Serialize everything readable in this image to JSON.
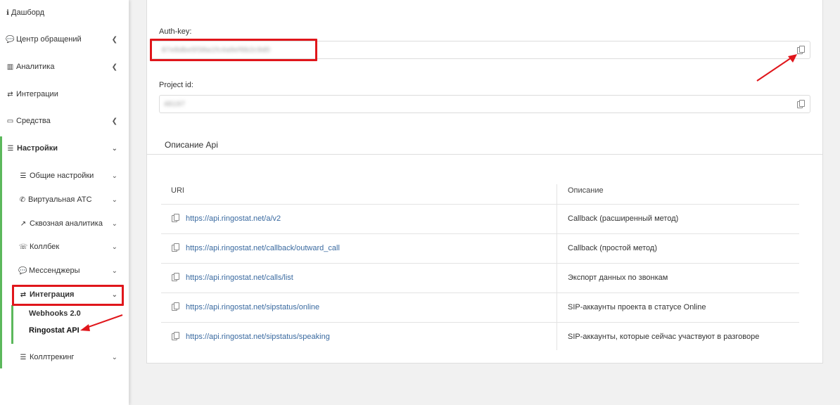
{
  "sidebar": {
    "items": [
      {
        "label": "Дашборд",
        "icon": "info-icon"
      },
      {
        "label": "Центр обращений",
        "icon": "chat-icon"
      },
      {
        "label": "Аналитика",
        "icon": "bar-chart-icon"
      },
      {
        "label": "Интеграции",
        "icon": "exchange-icon"
      },
      {
        "label": "Средства",
        "icon": "credit-card-icon"
      },
      {
        "label": "Настройки",
        "icon": "sliders-icon"
      },
      {
        "label": "Общие настройки",
        "icon": "sliders-icon"
      },
      {
        "label": "Виртуальная АТС",
        "icon": "phone-icon"
      },
      {
        "label": "Сквозная аналитика",
        "icon": "line-chart-icon"
      },
      {
        "label": "Коллбек",
        "icon": "callback-icon"
      },
      {
        "label": "Мессенджеры",
        "icon": "chat-icon"
      },
      {
        "label": "Интеграция",
        "icon": "exchange-icon"
      },
      {
        "label": "Webhooks 2.0"
      },
      {
        "label": "Ringostat API"
      },
      {
        "label": "Коллтрекинг",
        "icon": "sliders-icon"
      }
    ]
  },
  "auth": {
    "label": "Auth-key:",
    "value": "87e8dbe5f38a1fc4a9ef6b2c9d0"
  },
  "project": {
    "label": "Project id:",
    "value": "48197"
  },
  "tab": "Описание Api",
  "table": {
    "headers": [
      "URI",
      "Описание"
    ],
    "rows": [
      {
        "uri": "https://api.ringostat.net/a/v2",
        "desc": "Callback (расширенный метод)"
      },
      {
        "uri": "https://api.ringostat.net/callback/outward_call",
        "desc": "Callback (простой метод)"
      },
      {
        "uri": "https://api.ringostat.net/calls/list",
        "desc": "Экспорт данных по звонкам"
      },
      {
        "uri": "https://api.ringostat.net/sipstatus/online",
        "desc": "SIP-аккаунты проекта в статусе Online"
      },
      {
        "uri": "https://api.ringostat.net/sipstatus/speaking",
        "desc": "SIP-аккаунты, которые сейчас участвуют в разговоре"
      }
    ]
  },
  "colors": {
    "accent_green": "#5cb85c",
    "highlight_red": "#e0161b",
    "link_blue": "#3a6aa0"
  }
}
